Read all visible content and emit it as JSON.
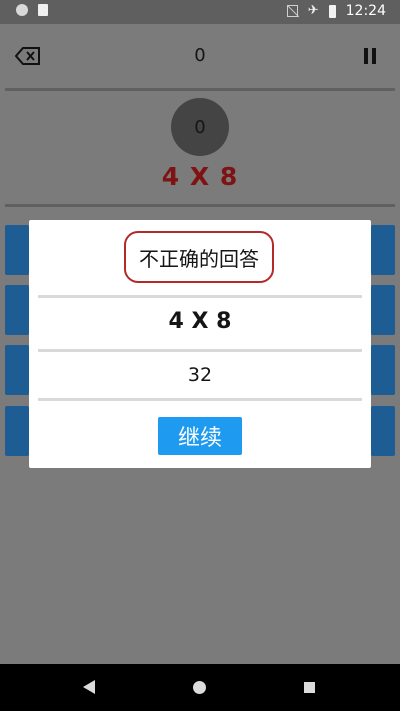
{
  "status_bar": {
    "time": "12:24",
    "icons": [
      "circle-status-icon",
      "sd-card-icon",
      "no-sim-icon",
      "airplane-mode-icon",
      "battery-icon"
    ]
  },
  "toolbar": {
    "score": "0",
    "back_icon": "backspace-icon",
    "pause_icon": "pause-icon"
  },
  "game": {
    "counter": "0",
    "question": "4 X 8"
  },
  "dialog": {
    "title": "不正确的回答",
    "question": "4 X 8",
    "answer": "32",
    "continue_label": "继续"
  },
  "colors": {
    "question": "#7f1212",
    "dialog_title_border": "#b32a2a",
    "continue_button": "#1e9bf0",
    "answer_buttons": "#1d5d93"
  },
  "nav_bar": {
    "icons": [
      "back-icon",
      "home-icon",
      "recent-apps-icon"
    ]
  }
}
